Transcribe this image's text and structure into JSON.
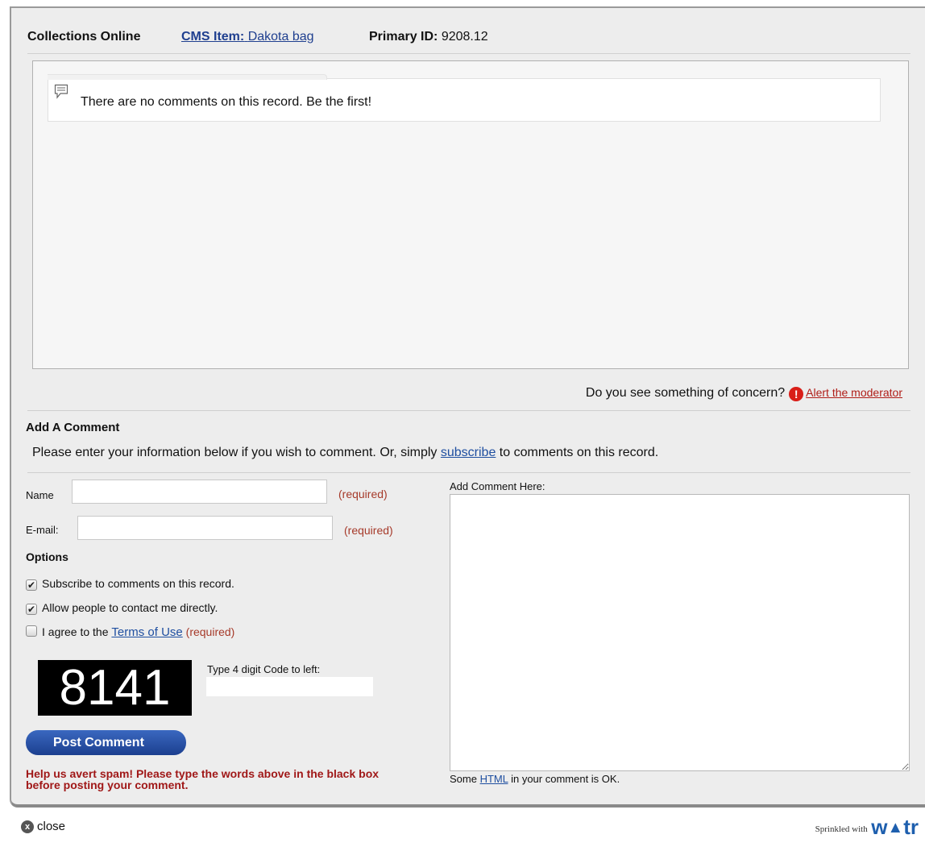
{
  "header": {
    "title": "Collections Online",
    "cms_label": "CMS Item:",
    "cms_value": "Dakota bag",
    "primary_label": "Primary ID:",
    "primary_value": "9208.12"
  },
  "comments": {
    "empty_message": "There are no comments on this record. Be the first!"
  },
  "concern": {
    "question": "Do you see something of concern?",
    "link": "Alert the moderator",
    "icon": "exclamation-icon"
  },
  "add_comment": {
    "title": "Add A Comment",
    "intro_before": "Please enter your information below if you wish to comment. Or, simply ",
    "intro_link": "subscribe",
    "intro_after": " to comments on this record."
  },
  "form": {
    "name_label": "Name",
    "name_required": "(required)",
    "email_label": "E-mail:",
    "email_required": "(required)",
    "options_title": "Options",
    "options": [
      {
        "label": "Subscribe to comments on this record.",
        "checked": true
      },
      {
        "label": "Allow people to contact me directly.",
        "checked": true
      }
    ],
    "terms_prefix": "I agree to the ",
    "terms_link": "Terms of Use",
    "terms_required": "(required)",
    "captcha_code": "8141",
    "code_label": "Type 4 digit Code to left:",
    "post_button": "Post Comment",
    "spam_note": "Help us avert spam! Please type the words above in the black box before posting your comment.",
    "comment_label": "Add Comment Here:",
    "html_note_before": "Some ",
    "html_note_link": "HTML",
    "html_note_after": " in your comment is OK."
  },
  "footer": {
    "close_label": "close",
    "sprinkled_text": "Sprinkled with",
    "brand": "w&#x25B2;tr"
  }
}
